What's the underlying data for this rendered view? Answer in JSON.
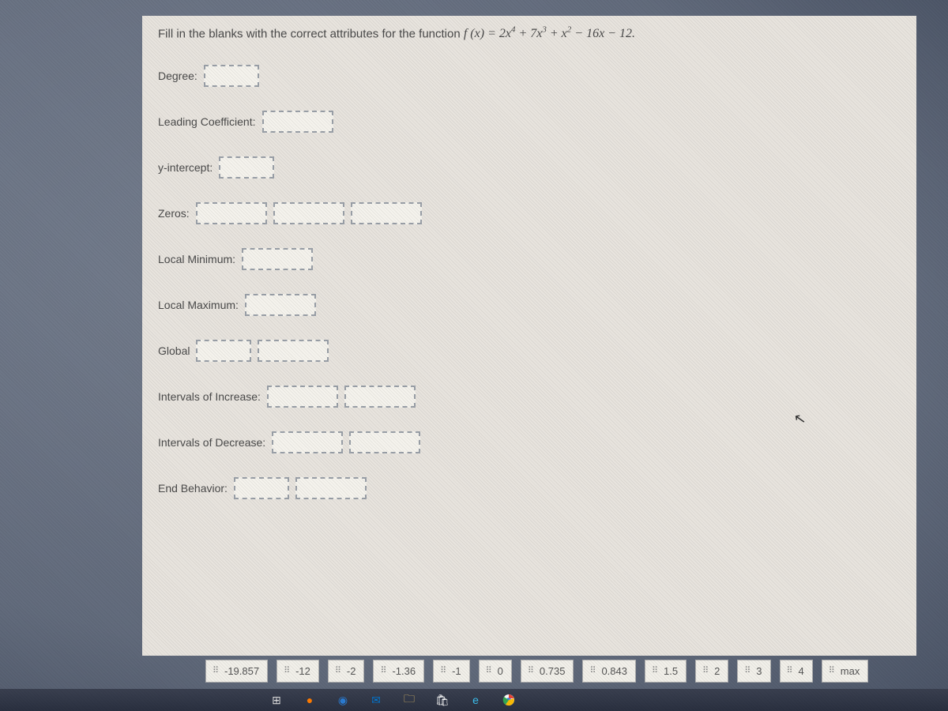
{
  "prompt": {
    "intro": "Fill in the blanks with the correct attributes for the function ",
    "func": "f (x) = 2x",
    "e4": "4",
    "p1": " + 7x",
    "e3": "3",
    "p2": " + x",
    "e2": "2",
    "p3": " − 16x − 12.",
    "full_text": "Fill in the blanks with the correct attributes for the function f(x) = 2x^4 + 7x^3 + x^2 − 16x − 12."
  },
  "labels": {
    "degree": "Degree:",
    "leading_coeff": "Leading Coefficient:",
    "y_intercept": "y-intercept:",
    "zeros": "Zeros:",
    "local_min": "Local Minimum:",
    "local_max": "Local Maximum:",
    "global": "Global",
    "intervals_inc": "Intervals of Increase:",
    "intervals_dec": "Intervals of Decrease:",
    "end_behavior": "End Behavior:"
  },
  "tiles": [
    "-19.857",
    "-12",
    "-2",
    "-1.36",
    "-1",
    "0",
    "0.735",
    "0.843",
    "1.5",
    "2",
    "3",
    "4",
    "max"
  ]
}
